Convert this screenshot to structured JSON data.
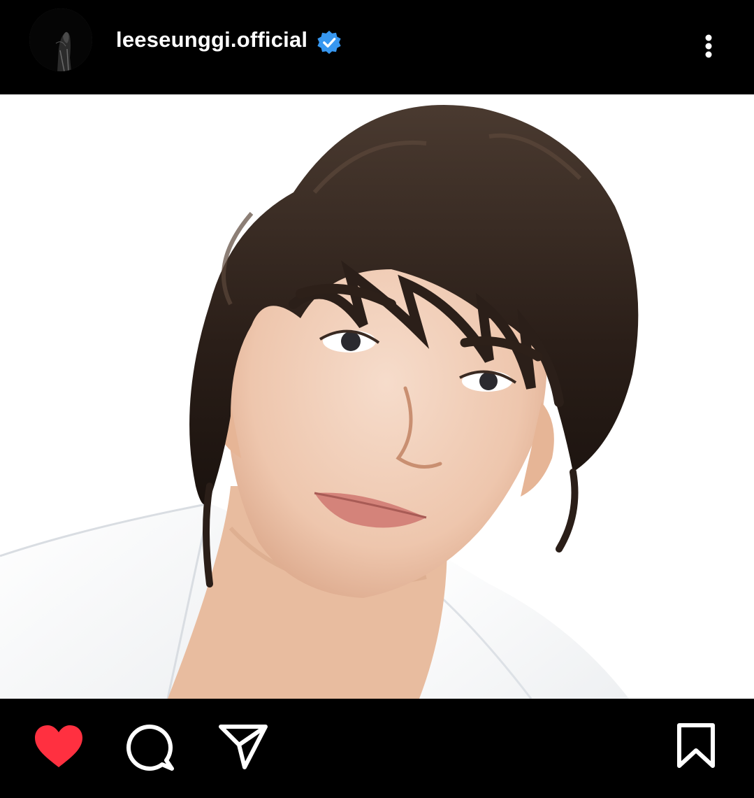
{
  "post": {
    "username": "leeseunggi.official",
    "verified": true,
    "liked": true
  },
  "icons": {
    "avatar": "profile-avatar",
    "verified": "verified-badge-icon",
    "more": "more-options-icon",
    "like": "heart-icon",
    "comment": "comment-icon",
    "share": "paper-plane-icon",
    "save": "bookmark-icon"
  },
  "colors": {
    "background": "#000000",
    "text": "#ffffff",
    "verified": "#3797f0",
    "like": "#ff3040"
  }
}
